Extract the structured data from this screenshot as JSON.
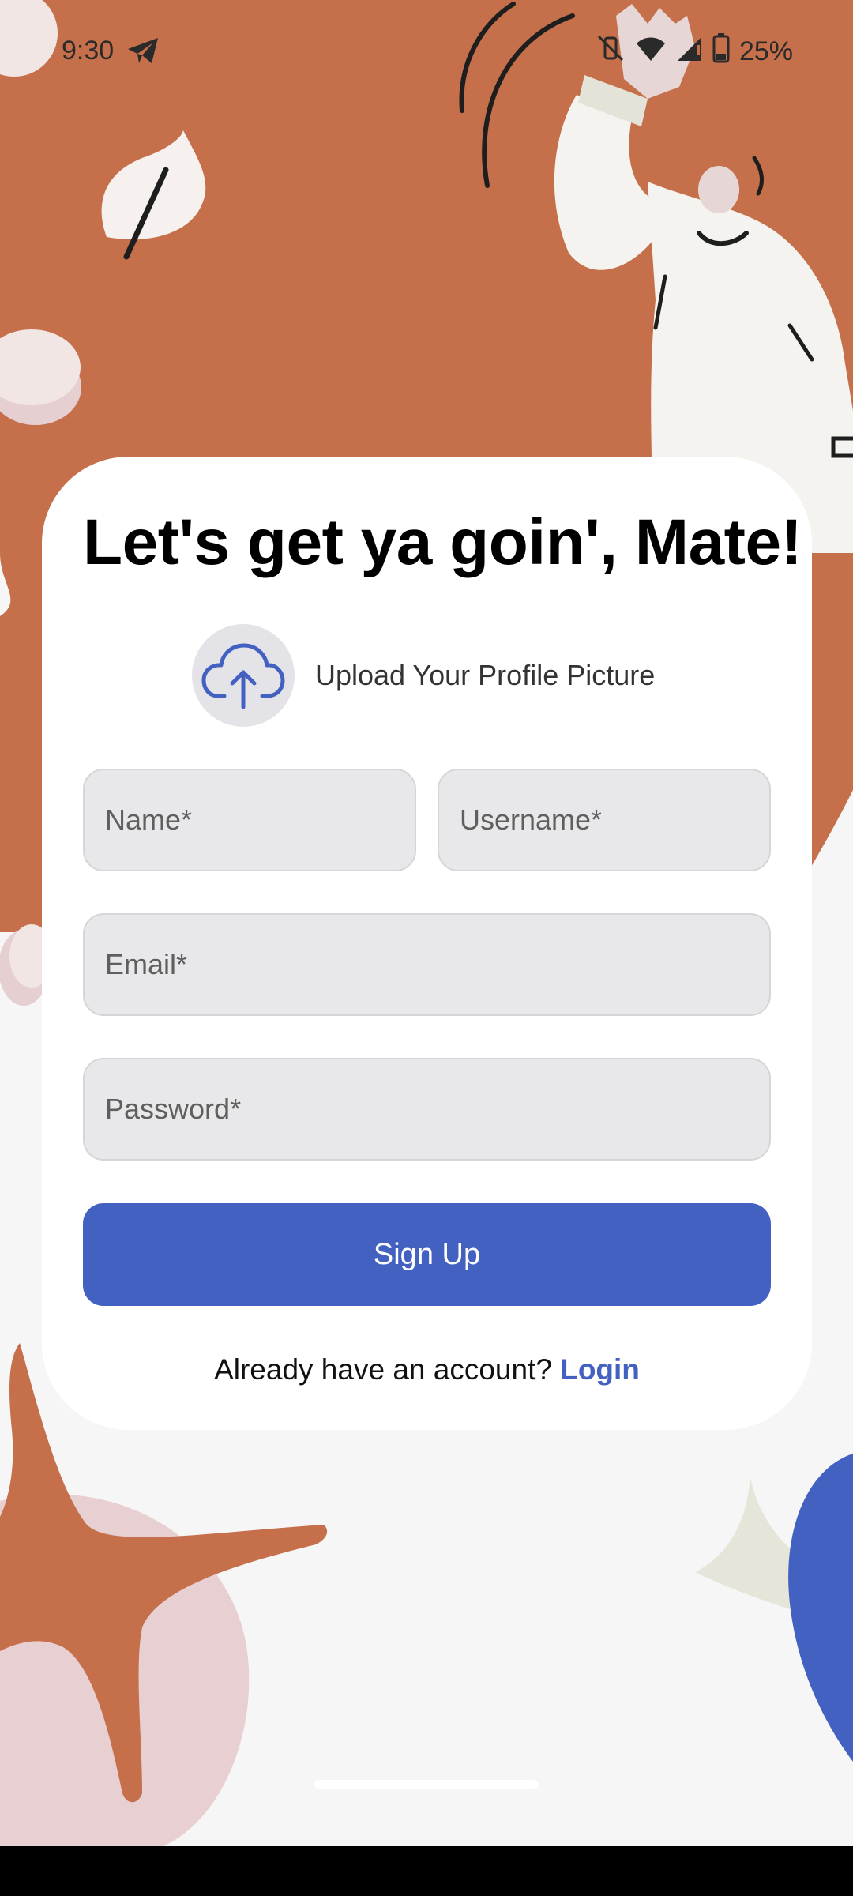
{
  "status_bar": {
    "time": "9:30",
    "battery_percent": "25%",
    "icons": [
      "telegram-icon",
      "vibrate-off-icon",
      "wifi-icon",
      "signal-icon",
      "battery-icon"
    ]
  },
  "form": {
    "title": "Let's get ya goin', Mate!",
    "upload_label": "Upload Your Profile Picture",
    "upload_icon": "cloud-upload-icon",
    "name_placeholder": "Name*",
    "username_placeholder": "Username*",
    "email_placeholder": "Email*",
    "password_placeholder": "Password*",
    "signup_label": "Sign Up",
    "login_prompt": "Already have an account?",
    "login_label": "Login"
  },
  "colors": {
    "background_orange": "#c5704a",
    "accent_blue": "#4361c0",
    "card": "#ffffff",
    "field_bg": "#e8e8ea",
    "page_bg": "#f6f6f6"
  }
}
